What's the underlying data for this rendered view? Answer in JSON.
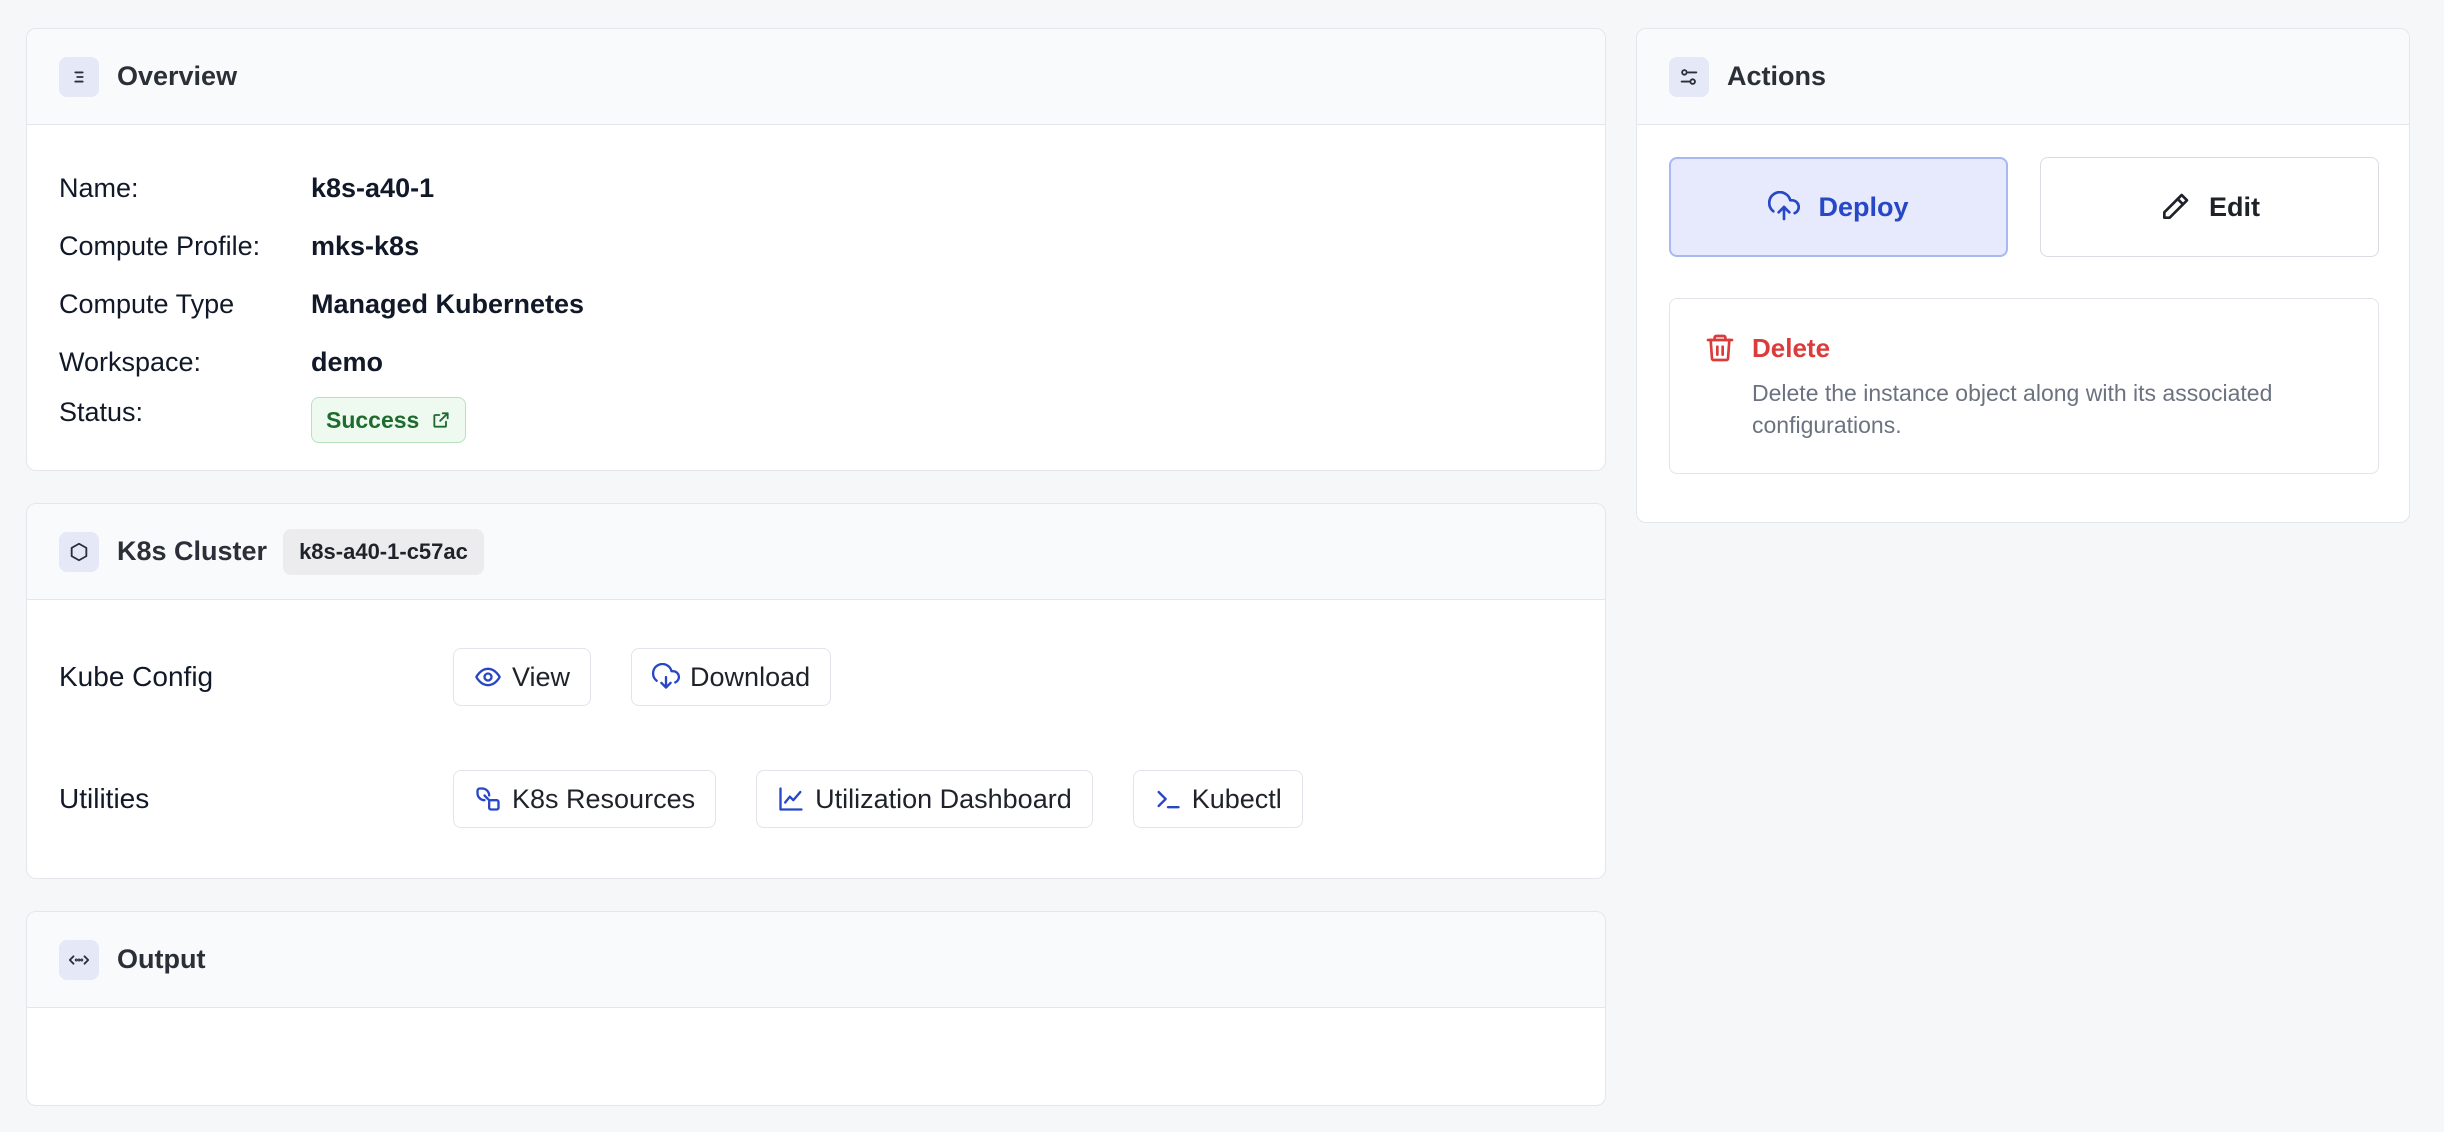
{
  "overview": {
    "title": "Overview",
    "fields": [
      {
        "label": "Name:",
        "value": "k8s-a40-1"
      },
      {
        "label": "Compute Profile:",
        "value": "mks-k8s"
      },
      {
        "label": "Compute Type",
        "value": "Managed Kubernetes"
      },
      {
        "label": "Workspace:",
        "value": "demo"
      }
    ],
    "status_label": "Status:",
    "status_value": "Success"
  },
  "cluster": {
    "title": "K8s Cluster",
    "tag": "k8s-a40-1-c57ac",
    "kube_config_label": "Kube Config",
    "view_label": "View",
    "download_label": "Download",
    "utilities_label": "Utilities",
    "k8s_resources_label": "K8s Resources",
    "utilization_dashboard_label": "Utilization Dashboard",
    "kubectl_label": "Kubectl"
  },
  "output": {
    "title": "Output"
  },
  "actions": {
    "title": "Actions",
    "deploy_label": "Deploy",
    "edit_label": "Edit",
    "delete_title": "Delete",
    "delete_description": "Delete the instance object along with its associated configurations."
  },
  "colors": {
    "accent_blue": "#2747c7",
    "success_green": "#1f6b2e",
    "danger_red": "#dc3b3b"
  },
  "icons": [
    "overview-list-icon",
    "external-link-icon",
    "cluster-hexagon-icon",
    "eye-icon",
    "cloud-download-icon",
    "resources-icon",
    "chart-line-icon",
    "terminal-icon",
    "code-icon",
    "sliders-icon",
    "cloud-upload-icon",
    "pencil-icon",
    "trash-icon"
  ]
}
